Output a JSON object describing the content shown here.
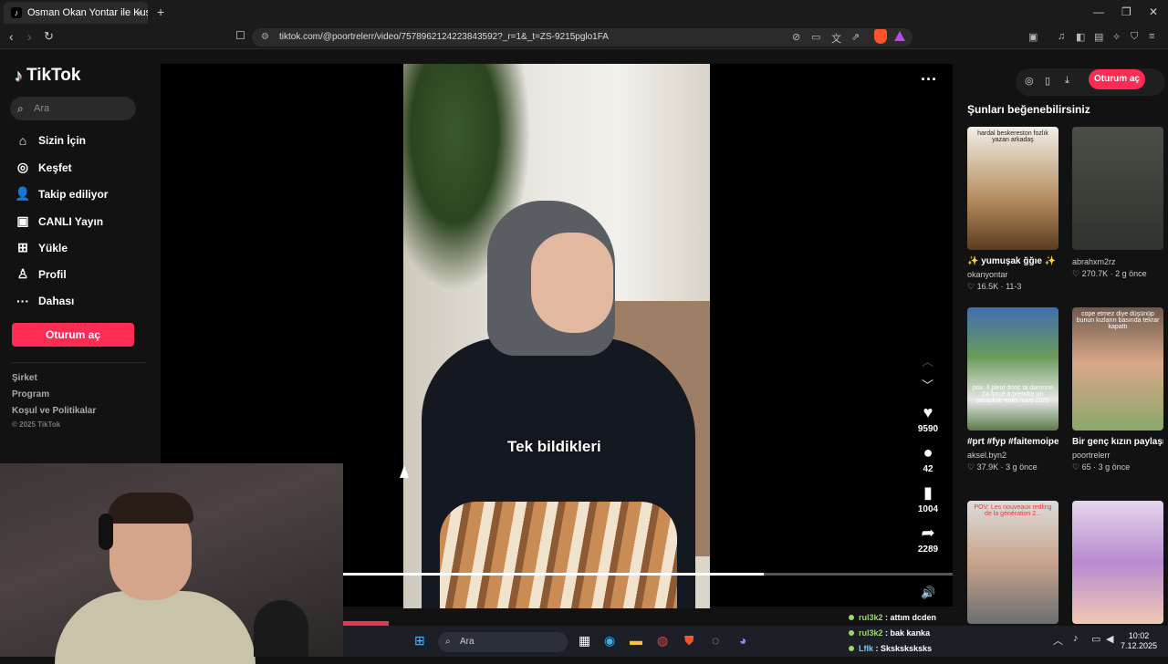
{
  "browser": {
    "tab_title": "Osman Okan Yontar ile Kuşak",
    "tab_close": "×",
    "new_tab": "+",
    "url": "tiktok.com/@poortrelerr/video/7578962124223843592?_r=1&_t=ZS-9215pglo1FA"
  },
  "sidebar": {
    "logo": "TikTok",
    "search_placeholder": "Ara",
    "nav": [
      {
        "label": "Sizin İçin",
        "icon": "home-icon",
        "glyph": "⌂"
      },
      {
        "label": "Keşfet",
        "icon": "compass-icon",
        "glyph": "◎"
      },
      {
        "label": "Takip ediliyor",
        "icon": "following-icon",
        "glyph": "👤"
      },
      {
        "label": "CANLI Yayın",
        "icon": "live-icon",
        "glyph": "▣"
      },
      {
        "label": "Yükle",
        "icon": "upload-icon",
        "glyph": "⊞"
      },
      {
        "label": "Profil",
        "icon": "profile-icon",
        "glyph": "♙"
      },
      {
        "label": "Dahası",
        "icon": "more-icon",
        "glyph": "···"
      }
    ],
    "login_label": "Oturum aç",
    "footer_links": [
      "Şirket",
      "Program",
      "Koşul ve Politikalar"
    ],
    "copyright": "© 2025 TikTok"
  },
  "video": {
    "caption": "Tek bildikleri",
    "progress": 0.69,
    "likes": "9590",
    "comments": "42",
    "saves": "1004",
    "shares": "2289"
  },
  "right": {
    "login_label": "Oturum aç",
    "suggest_title": "Şunları beğenebilirsiniz",
    "cards": [
      {
        "overlay": "hardal beskereston fozlık yazan arkadaş",
        "title": "✨ yumuşak ğğıe ✨",
        "user": "okanyontar",
        "stats": "♡ 16.5K · 11-3",
        "color": "#7a5a38"
      },
      {
        "overlay": "",
        "title": "",
        "user": "abrahxm2rz",
        "stats": "♡ 270.7K · 2 g önce",
        "color": "#3e443c"
      },
      {
        "overlay": "pov: il pleut donc ta daronne t'a forcé à prendre un parapluie mais nous 2025",
        "title": "#prt #fyp #faitemoipercewes...",
        "user": "aksel.byn2",
        "stats": "♡ 37.9K · 3 g önce",
        "color": "#5a7a4a"
      },
      {
        "overlay": "cope etmez diye düşünüp bunun kızların basında tekrar kapattı",
        "title": "Bir genç kızın paylaşımı:...",
        "user": "poortrelerr",
        "stats": "♡ 65 · 3 g önce",
        "color": "#8a6a5a"
      },
      {
        "overlay": "POV: Les nouveaux redling de la génération 2...",
        "title": "",
        "user": "",
        "stats": "",
        "color": "#8a8f94"
      },
      {
        "overlay": "",
        "title": "",
        "user": "",
        "stats": "",
        "color": "#c7a6c9"
      }
    ]
  },
  "stream": {
    "chat": [
      {
        "user": "rul3k2",
        "msg": ": attım dcden"
      },
      {
        "user": "rul3k2",
        "msg": ": bak kanka"
      },
      {
        "user": "Lflk",
        "msg": ": Sksksksksks"
      }
    ]
  },
  "taskbar": {
    "search_label": "Ara",
    "time": "10:02",
    "date": "7.12.2025"
  }
}
